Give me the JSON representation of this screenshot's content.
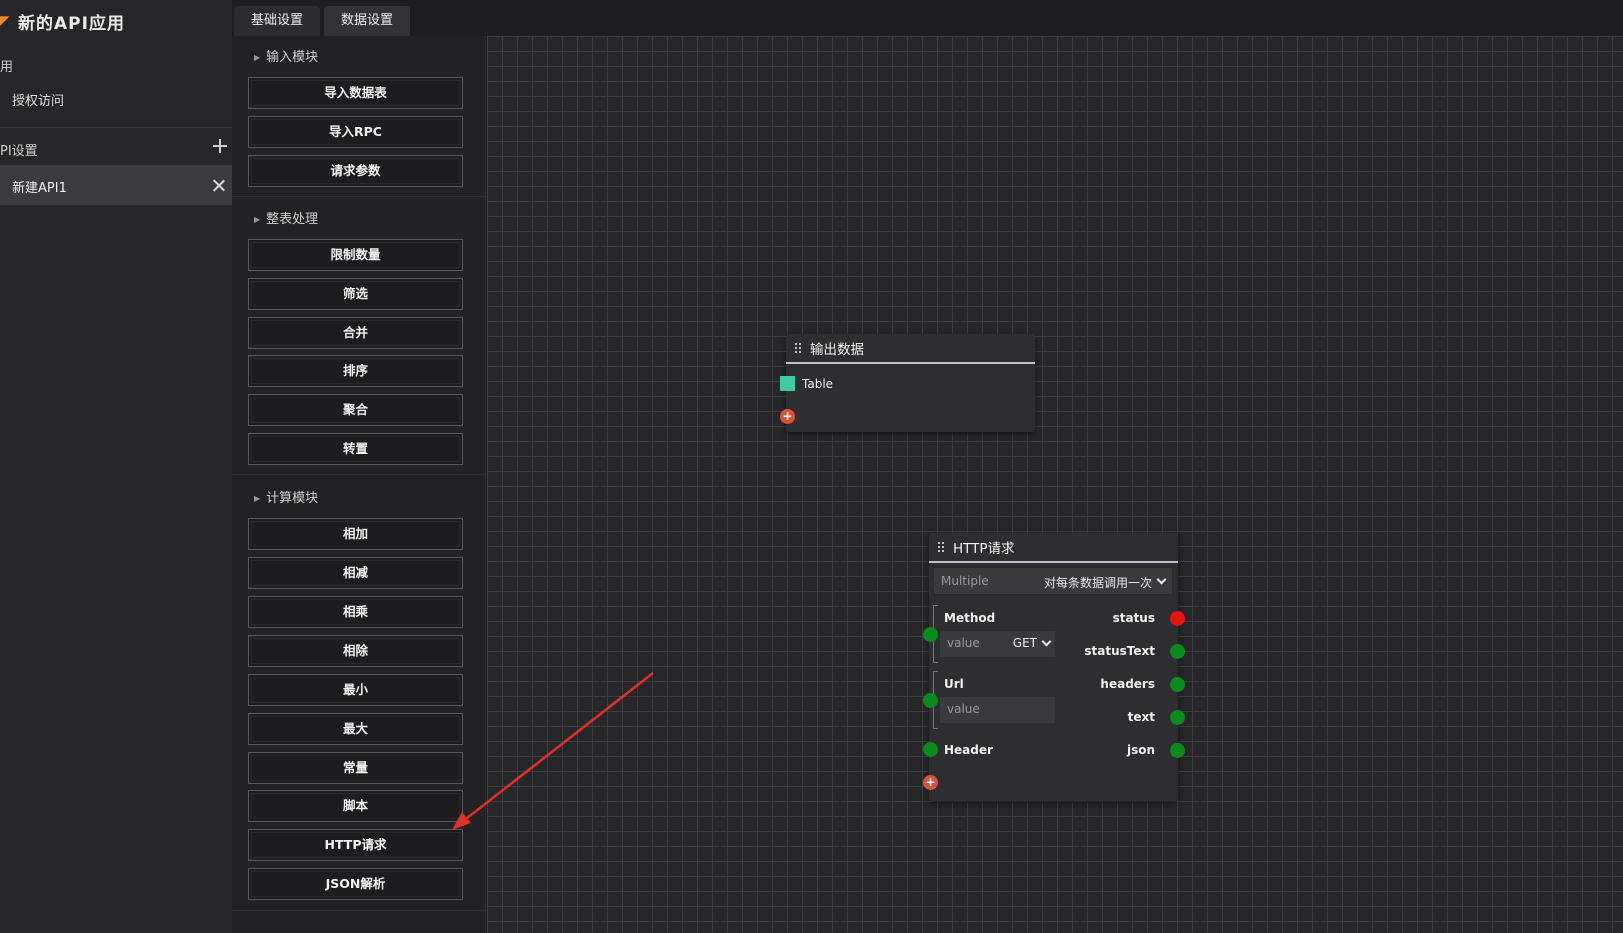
{
  "app": {
    "title": "新的API应用",
    "sections": {
      "general": "用",
      "auth_access": "授权访问",
      "api_settings": "PI设置",
      "active_api": "新建API1"
    }
  },
  "tabs": [
    {
      "label": "基础设置"
    },
    {
      "label": "数据设置"
    }
  ],
  "palette": {
    "groups": [
      {
        "title": "输入模块",
        "items": [
          "导入数据表",
          "导入RPC",
          "请求参数"
        ]
      },
      {
        "title": "整表处理",
        "items": [
          "限制数量",
          "筛选",
          "合并",
          "排序",
          "聚合",
          "转置"
        ]
      },
      {
        "title": "计算模块",
        "items": [
          "相加",
          "相减",
          "相乘",
          "相除",
          "最小",
          "最大",
          "常量",
          "脚本",
          "HTTP请求",
          "JSON解析"
        ]
      }
    ]
  },
  "nodes": {
    "output": {
      "title": "输出数据",
      "input_label": "Table",
      "port_color": "#3cc9a4"
    },
    "http": {
      "title": "HTTP请求",
      "mode_placeholder": "Multiple",
      "mode_value": "对每条数据调用一次",
      "method_label": "Method",
      "method_placeholder": "value",
      "method_value": "GET",
      "url_label": "Url",
      "url_placeholder": "value",
      "header_label": "Header",
      "outputs": [
        "status",
        "statusText",
        "headers",
        "text",
        "json"
      ],
      "colors": {
        "port_ok": "#0b8a1d",
        "port_status": "#e81212",
        "add": "#d9533c"
      }
    }
  },
  "annotation": {
    "arrow_color": "#e0302a"
  }
}
